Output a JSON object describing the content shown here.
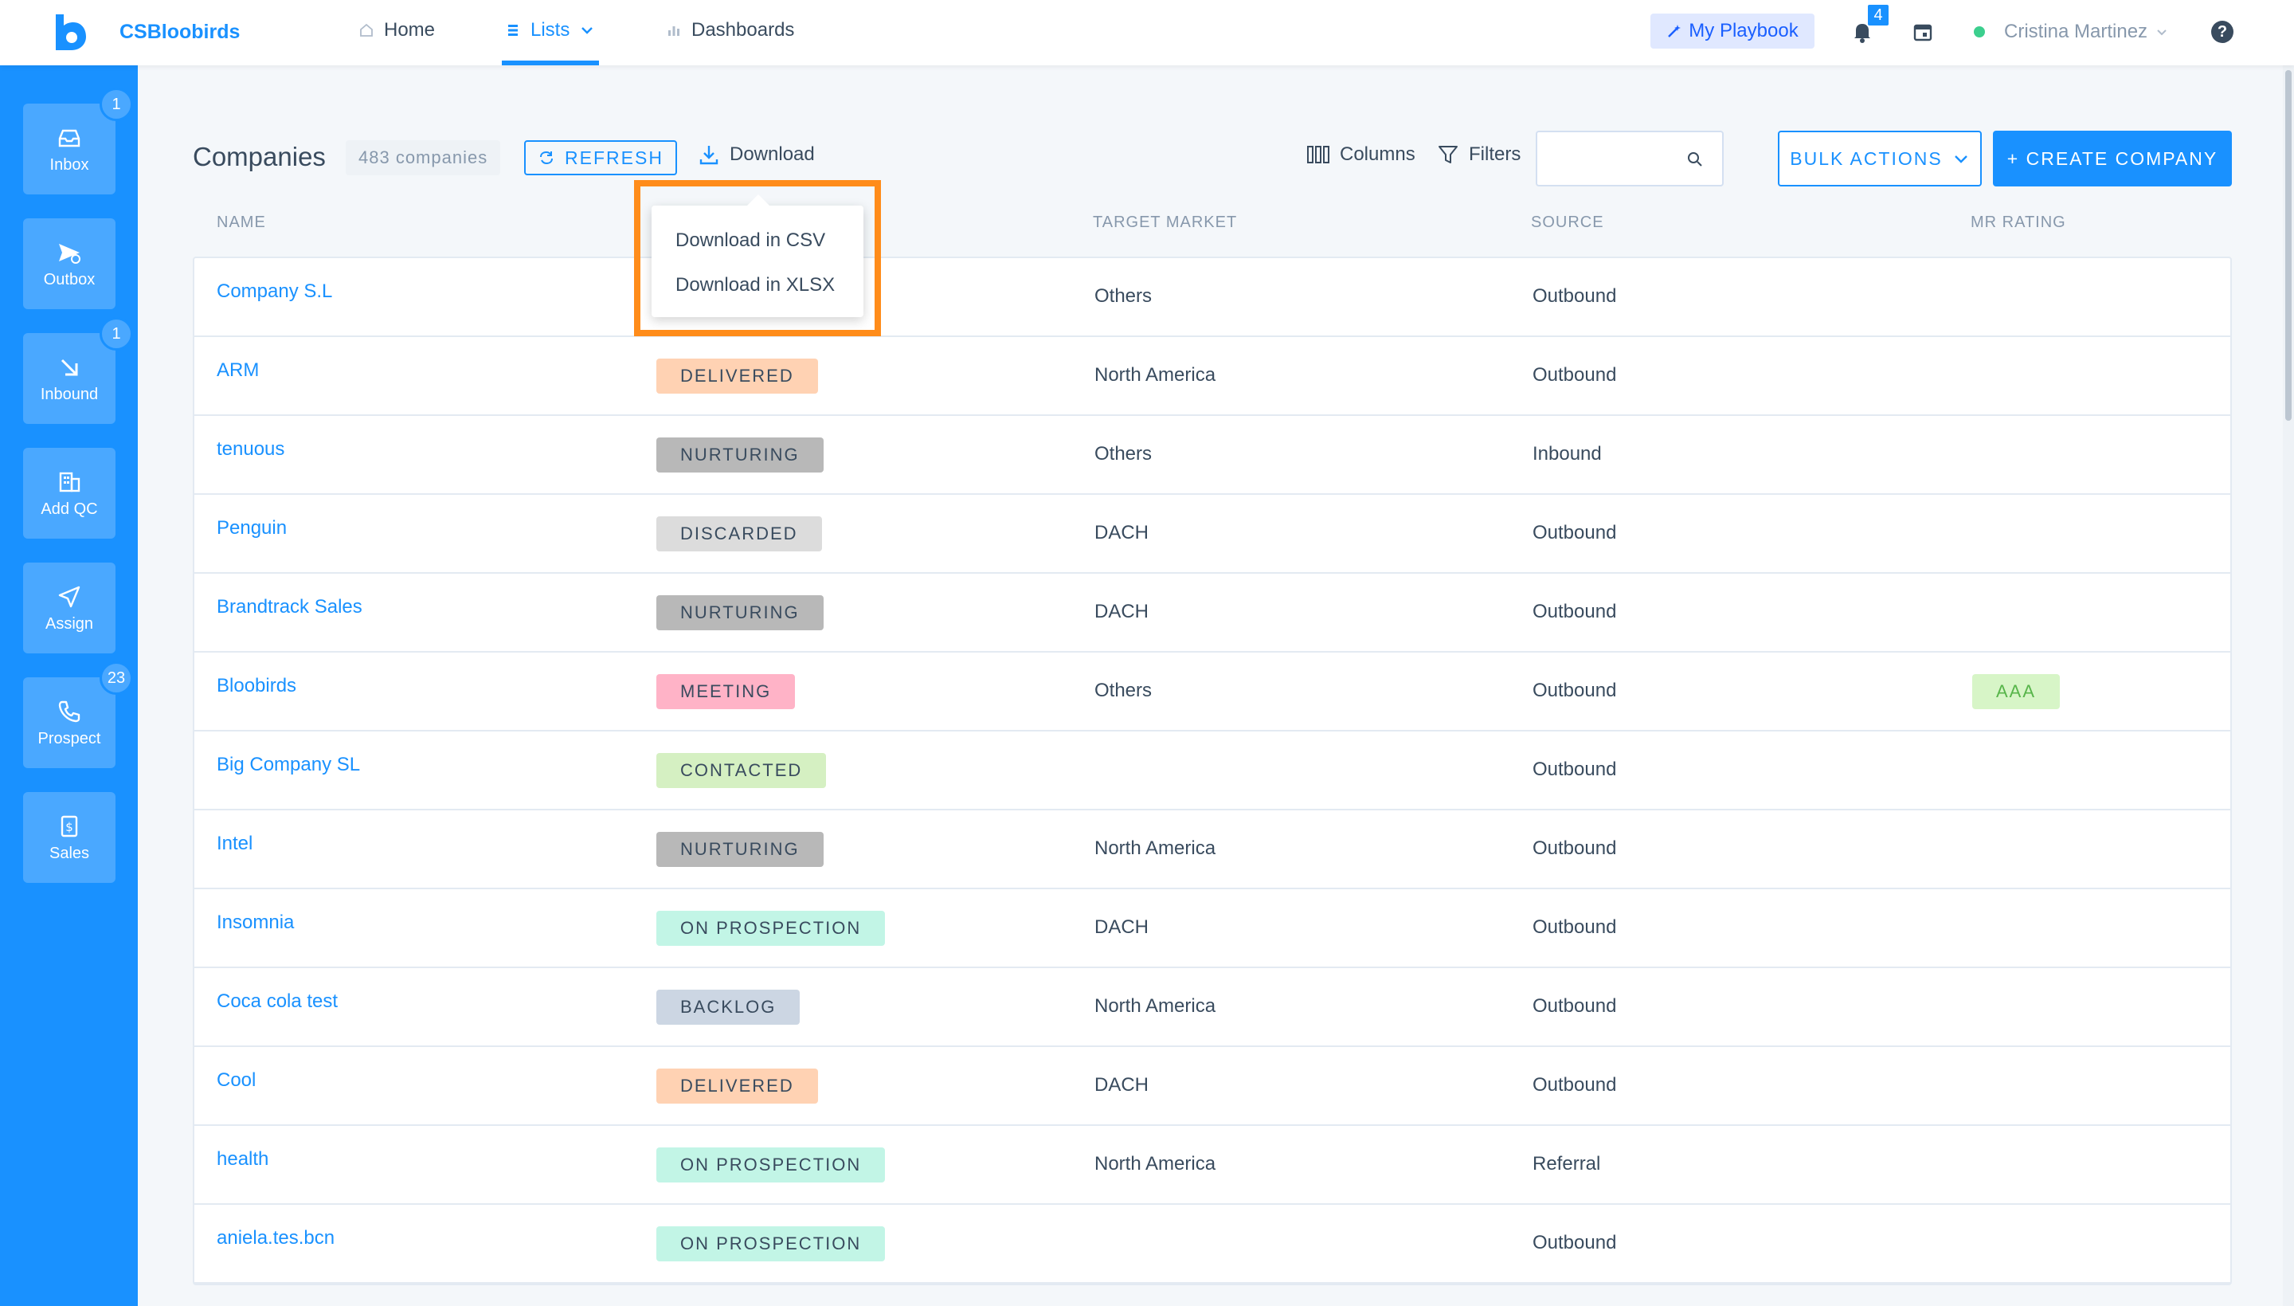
{
  "app": {
    "brand": "CSBloobirds"
  },
  "nav": {
    "home": "Home",
    "lists": "Lists",
    "dashboards": "Dashboards",
    "playbook": "My Playbook",
    "notifications_count": "4",
    "user_name": "Cristina Martinez",
    "help": "?"
  },
  "sidebar": {
    "items": [
      {
        "label": "Inbox",
        "badge": "1"
      },
      {
        "label": "Outbox",
        "badge": ""
      },
      {
        "label": "Inbound",
        "badge": "1"
      },
      {
        "label": "Add QC",
        "badge": ""
      },
      {
        "label": "Assign",
        "badge": ""
      },
      {
        "label": "Prospect",
        "badge": "23"
      },
      {
        "label": "Sales",
        "badge": ""
      }
    ]
  },
  "toolbar": {
    "title": "Companies",
    "count": "483 companies",
    "refresh": "REFRESH",
    "download": "Download",
    "columns": "Columns",
    "filters": "Filters",
    "search_placeholder": "",
    "bulk_actions": "BULK ACTIONS",
    "create": "+ CREATE COMPANY"
  },
  "download_menu": {
    "csv": "Download in CSV",
    "xlsx": "Download in XLSX"
  },
  "table": {
    "headers": {
      "name": "NAME",
      "target_market": "TARGET MARKET",
      "source": "SOURCE",
      "mr_rating": "MR RATING"
    },
    "rows": [
      {
        "name": "Company S.L",
        "status": "",
        "market": "Others",
        "source": "Outbound",
        "rating": ""
      },
      {
        "name": "ARM",
        "status": "DELIVERED",
        "market": "North America",
        "source": "Outbound",
        "rating": ""
      },
      {
        "name": "tenuous",
        "status": "NURTURING",
        "market": "Others",
        "source": "Inbound",
        "rating": ""
      },
      {
        "name": "Penguin",
        "status": "DISCARDED",
        "market": "DACH",
        "source": "Outbound",
        "rating": ""
      },
      {
        "name": "Brandtrack Sales",
        "status": "NURTURING",
        "market": "DACH",
        "source": "Outbound",
        "rating": ""
      },
      {
        "name": "Bloobirds",
        "status": "MEETING",
        "market": "Others",
        "source": "Outbound",
        "rating": "AAA"
      },
      {
        "name": "Big Company SL",
        "status": "CONTACTED",
        "market": "",
        "source": "Outbound",
        "rating": ""
      },
      {
        "name": "Intel",
        "status": "NURTURING",
        "market": "North America",
        "source": "Outbound",
        "rating": ""
      },
      {
        "name": "Insomnia",
        "status": "ON PROSPECTION",
        "market": "DACH",
        "source": "Outbound",
        "rating": ""
      },
      {
        "name": "Coca cola test",
        "status": "BACKLOG",
        "market": "North America",
        "source": "Outbound",
        "rating": ""
      },
      {
        "name": "Cool",
        "status": "DELIVERED",
        "market": "DACH",
        "source": "Outbound",
        "rating": ""
      },
      {
        "name": "health",
        "status": "ON PROSPECTION",
        "market": "North America",
        "source": "Referral",
        "rating": ""
      },
      {
        "name": "aniela.tes.bcn",
        "status": "ON PROSPECTION",
        "market": "",
        "source": "Outbound",
        "rating": ""
      }
    ]
  },
  "status_colors": {
    "DELIVERED": "#ffd2b3",
    "NURTURING": "#b8b8b8",
    "DISCARDED": "#dcdcdc",
    "MEETING": "#ffb3c7",
    "CONTACTED": "#d5f0c2",
    "ON PROSPECTION": "#c2f5e6",
    "BACKLOG": "#ccd6e3"
  },
  "colors": {
    "accent": "#1991ff",
    "highlight": "#ff8c1a"
  }
}
